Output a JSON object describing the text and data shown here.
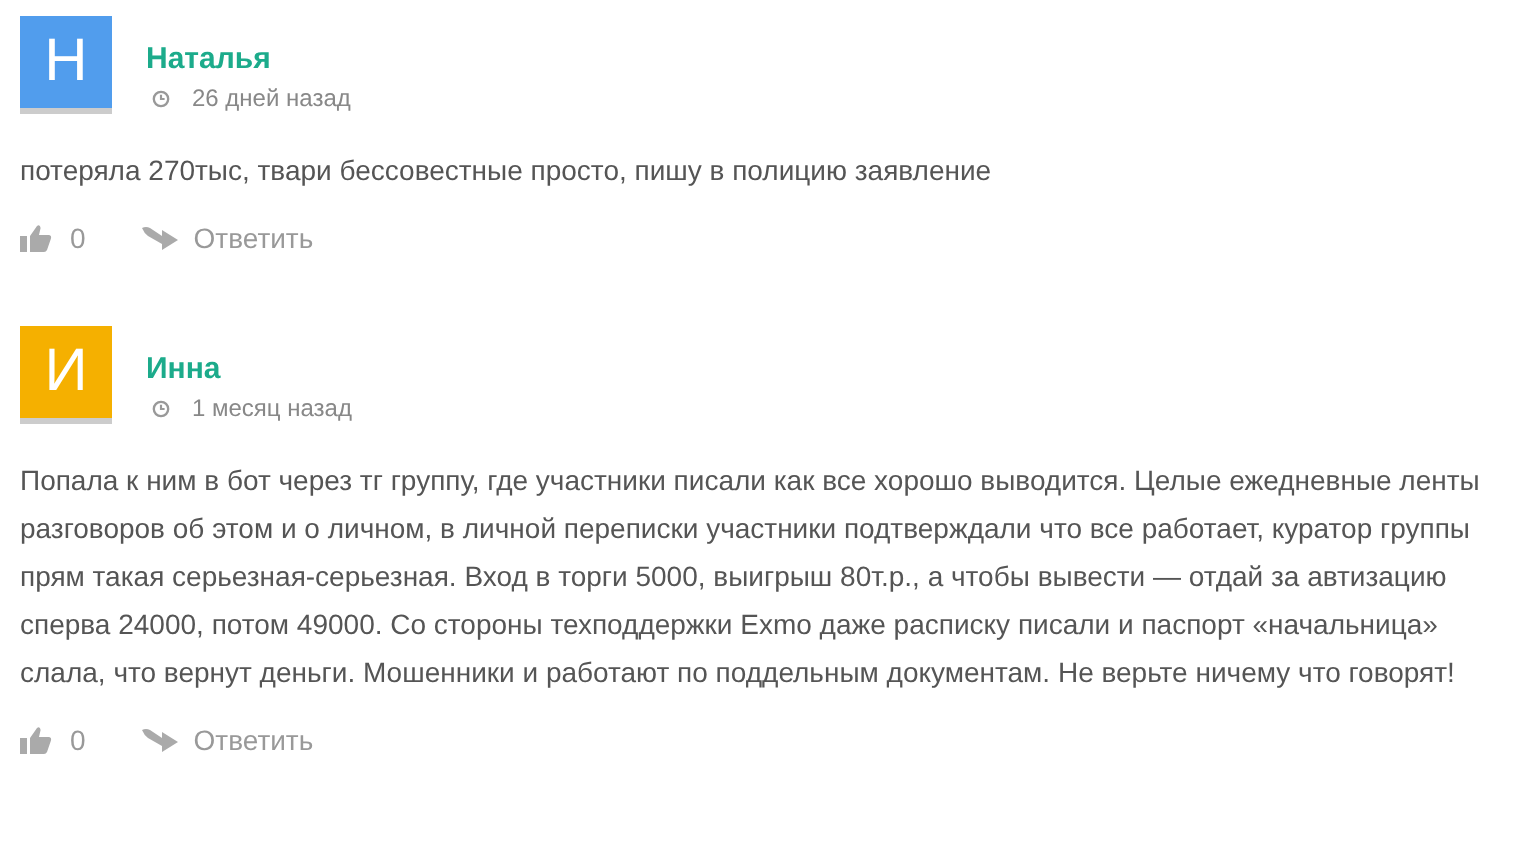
{
  "comments": [
    {
      "author": "Наталья",
      "initial": "Н",
      "color": "#519ded",
      "time": "26 дней назад",
      "text": "потеряла 270тыс, твари бессовестные просто, пишу в полицию заявление",
      "likes": "0",
      "reply": "Ответить"
    },
    {
      "author": "Инна",
      "initial": "И",
      "color": "#f5b000",
      "time": "1 месяц назад",
      "text": "Попала к ним в бот через тг группу, где участники писали как все хорошо выводится. Целые ежедневные ленты разговоров об этом и о личном, в личной переписки участники подтверждали что все работает, куратор группы прям такая серьезная-серьезная. Вход в торги 5000, выигрыш 80т.р., а чтобы вывести — отдай за автизацию сперва 24000, потом 49000. Со стороны техподдержки Exmo даже расписку писали и паспорт «начальница» слала, что вернут деньги. Мошенники и работают по поддельным документам. Не верьте ничему что говорят!",
      "likes": "0",
      "reply": "Ответить"
    }
  ]
}
